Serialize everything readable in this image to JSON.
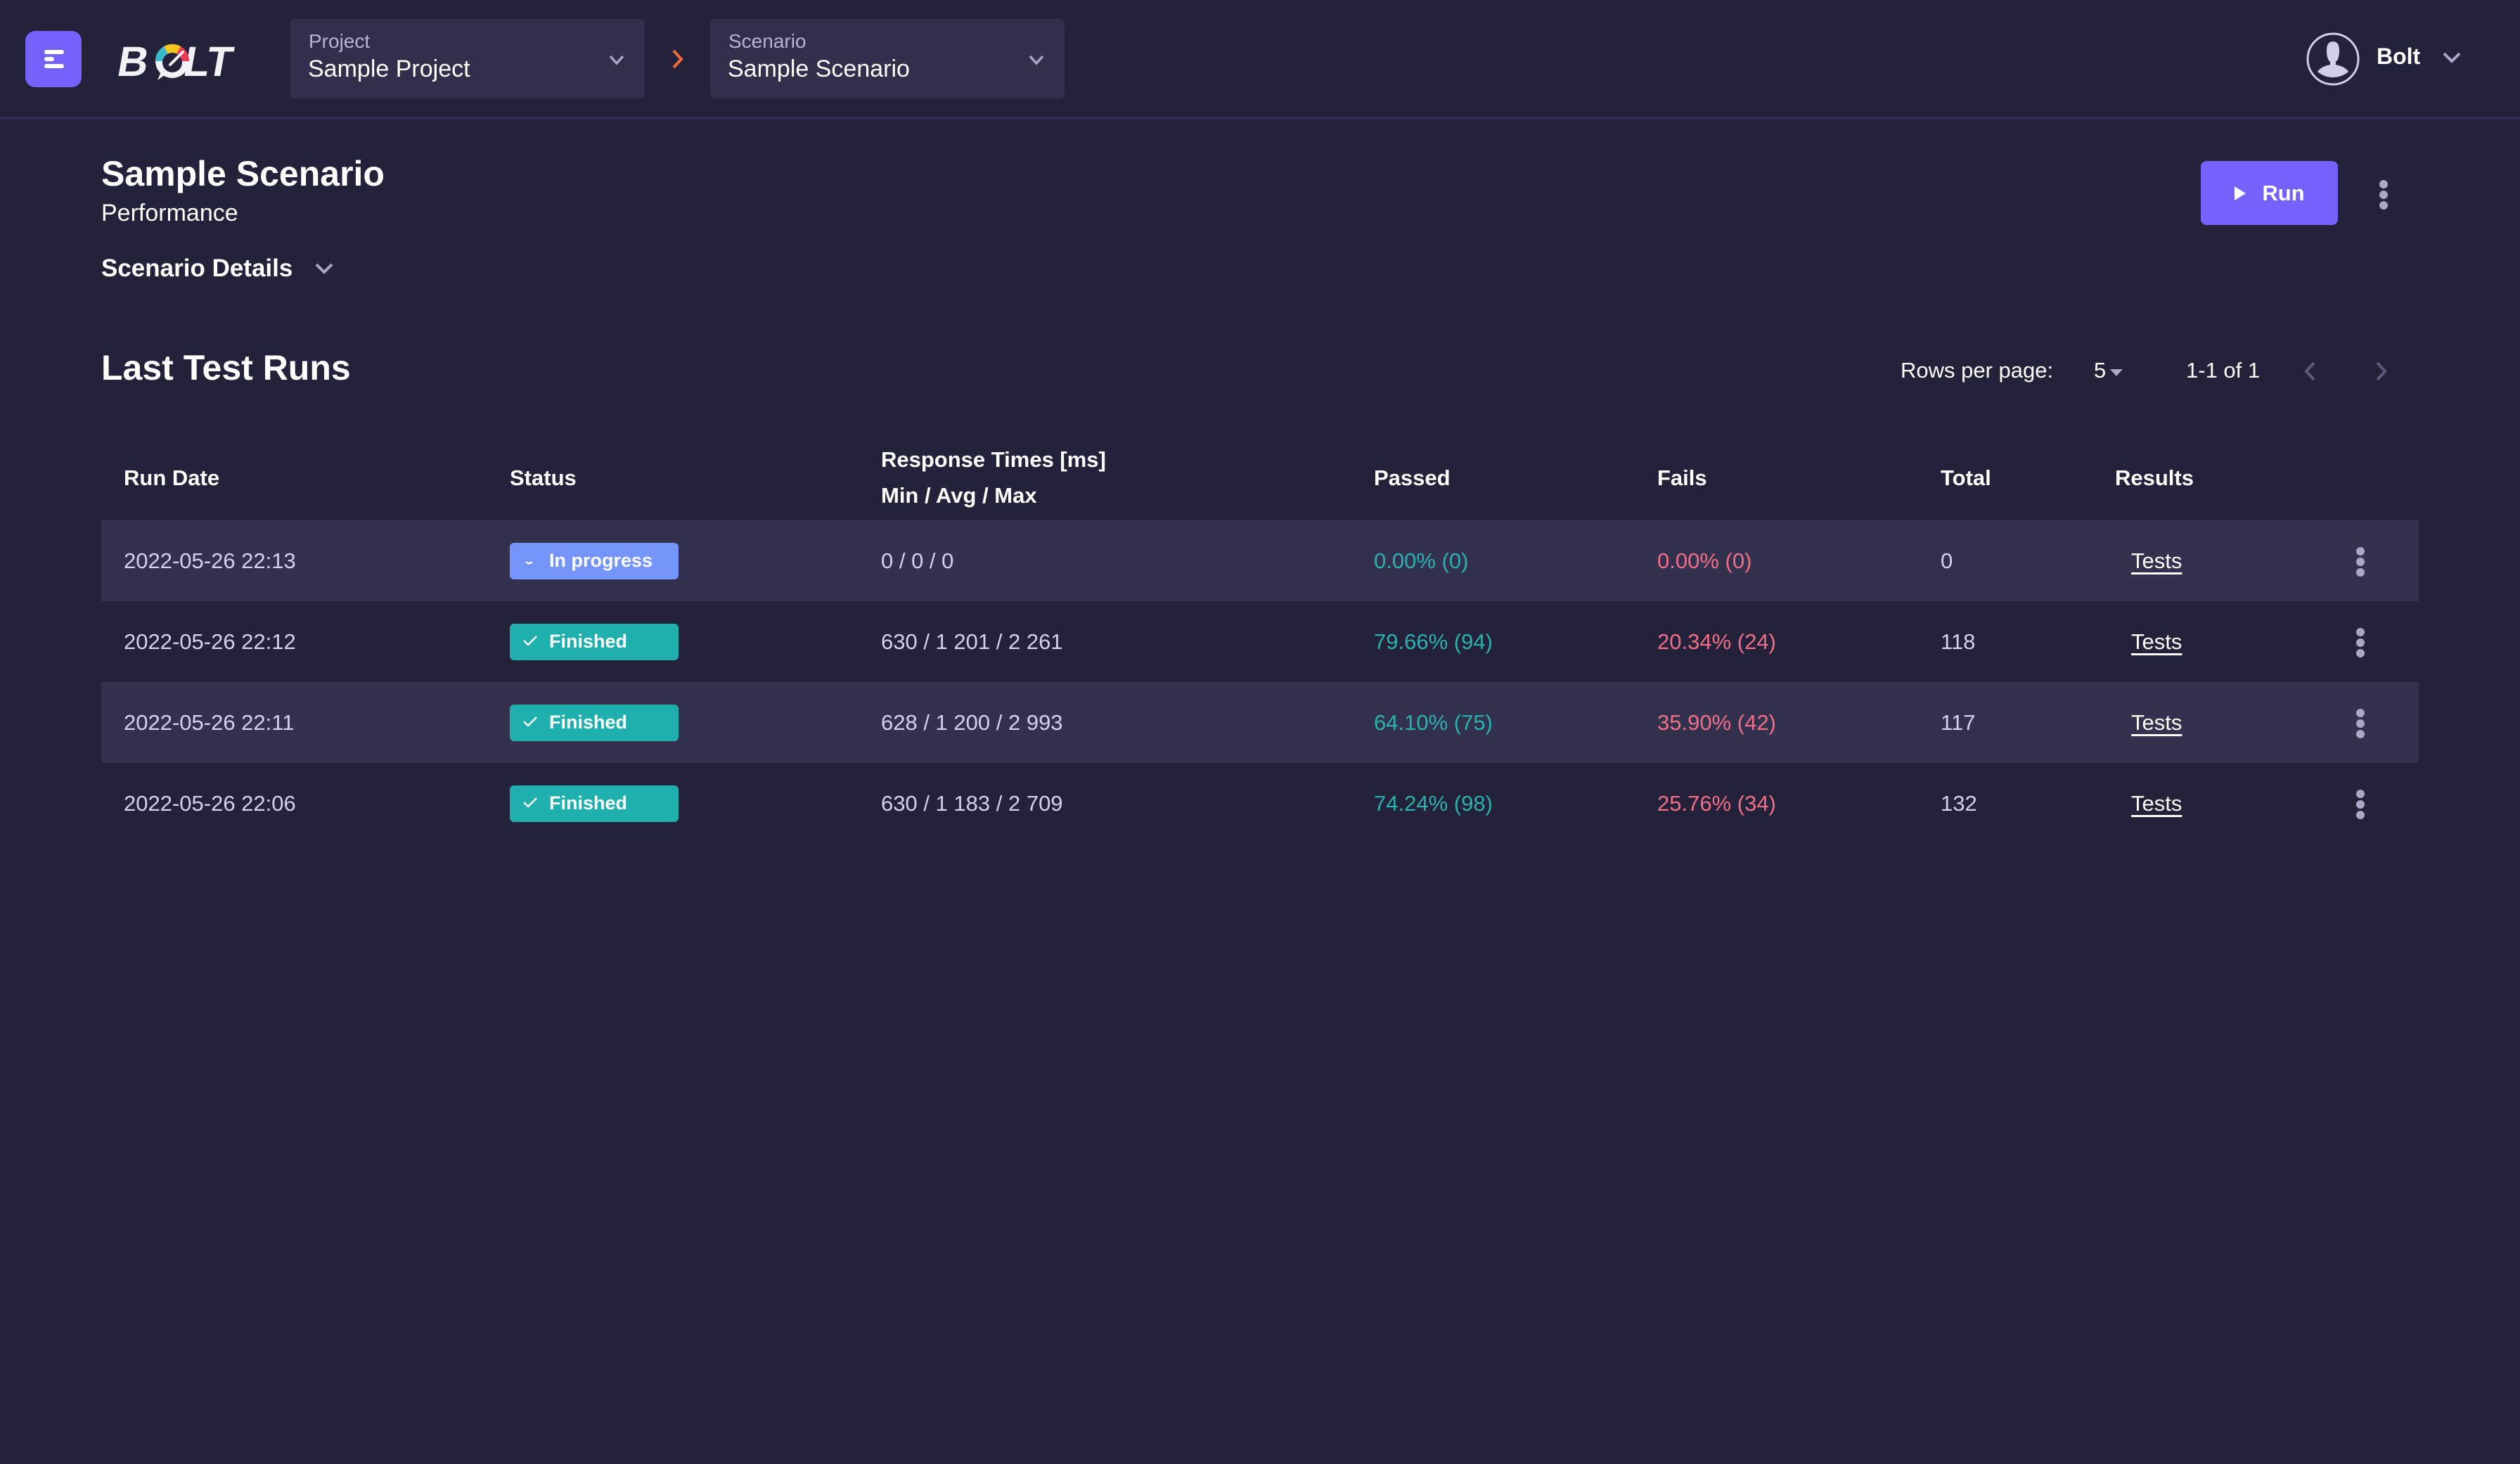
{
  "app": {
    "logo_text": "BOLT",
    "accent": "#7462fb",
    "background": "#23223a"
  },
  "header": {
    "project": {
      "label": "Project",
      "value": "Sample Project"
    },
    "scenario": {
      "label": "Scenario",
      "value": "Sample Scenario"
    },
    "user": {
      "name": "Bolt"
    }
  },
  "page": {
    "title": "Sample Scenario",
    "subtitle": "Performance",
    "details_toggle": "Scenario Details",
    "run_button": "Run"
  },
  "runs": {
    "title": "Last Test Runs",
    "pagination": {
      "rows_per_page_label": "Rows per page:",
      "rows_per_page": "5",
      "range": "1-1 of 1"
    },
    "columns": {
      "run_date": "Run Date",
      "status": "Status",
      "response_line1": "Response Times [ms]",
      "response_line2": "Min / Avg / Max",
      "passed": "Passed",
      "fails": "Fails",
      "total": "Total",
      "results": "Results"
    },
    "rows": [
      {
        "date": "2022-05-26 22:13",
        "status": "In progress",
        "status_type": "progress",
        "response": "0 / 0 / 0",
        "passed": "0.00% (0)",
        "fails": "0.00% (0)",
        "total": "0",
        "results": "Tests"
      },
      {
        "date": "2022-05-26 22:12",
        "status": "Finished",
        "status_type": "finished",
        "response": "630 / 1 201 / 2 261",
        "passed": "79.66% (94)",
        "fails": "20.34% (24)",
        "total": "118",
        "results": "Tests"
      },
      {
        "date": "2022-05-26 22:11",
        "status": "Finished",
        "status_type": "finished",
        "response": "628 / 1 200 / 2 993",
        "passed": "64.10% (75)",
        "fails": "35.90% (42)",
        "total": "117",
        "results": "Tests"
      },
      {
        "date": "2022-05-26 22:06",
        "status": "Finished",
        "status_type": "finished",
        "response": "630 / 1 183 / 2 709",
        "passed": "74.24% (98)",
        "fails": "25.76% (34)",
        "total": "132",
        "results": "Tests"
      }
    ]
  }
}
